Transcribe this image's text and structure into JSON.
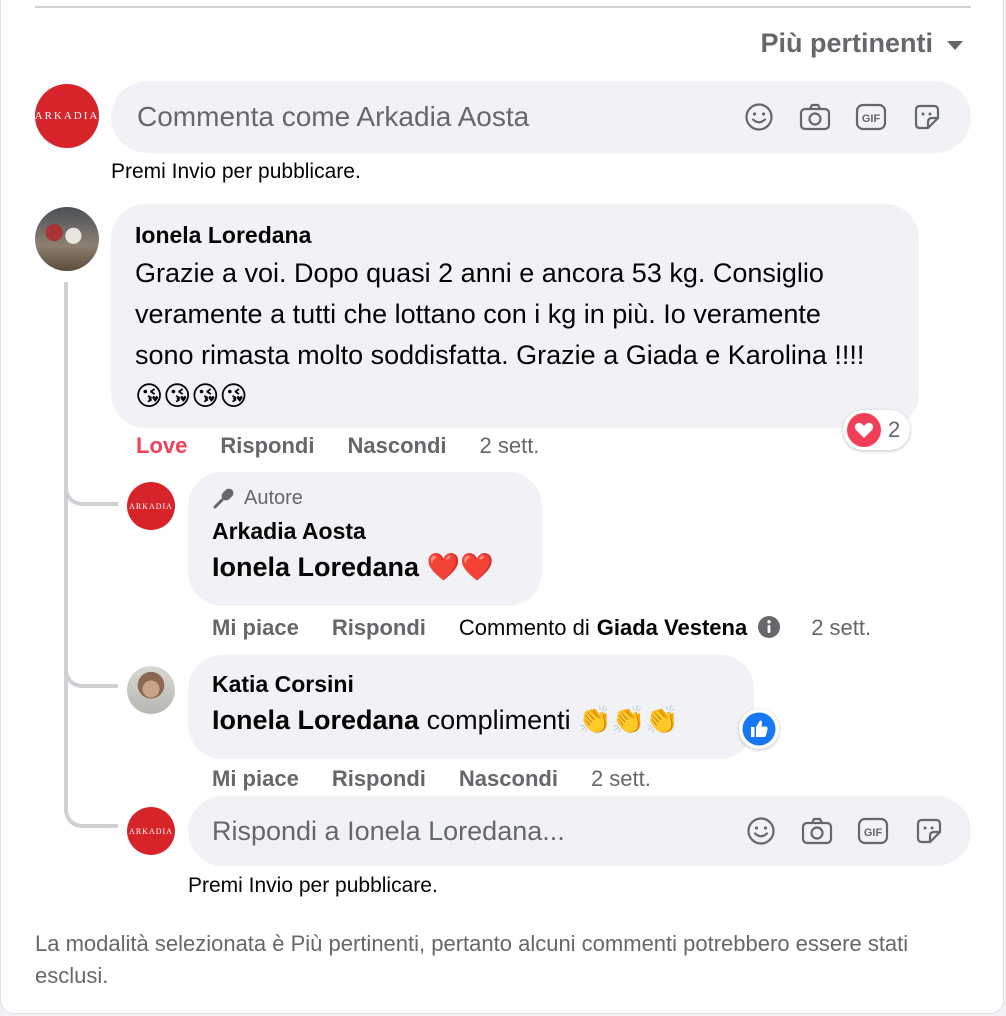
{
  "sort": {
    "label": "Più pertinenti"
  },
  "composer": {
    "placeholder": "Commenta come Arkadia Aosta",
    "hint": "Premi Invio per pubblicare.",
    "avatar_text": "ARKADIA"
  },
  "comment1": {
    "author": "Ionela Loredana",
    "text": "Grazie a voi. Dopo quasi 2 anni e ancora 53 kg. Consiglio veramente a tutti che lottano con i kg in più. Io veramente sono rimasta molto soddisfatta. Grazie a Giada e Karolina !!!! 😘😘😘😘",
    "actions": {
      "react": "Love",
      "reply": "Rispondi",
      "hide": "Nascondi",
      "time": "2 sett."
    },
    "reaction_count": "2",
    "reaction_type": "heart-icon"
  },
  "reply1": {
    "badge": "Autore",
    "author": "Arkadia Aosta",
    "mention": "Ionela Loredana",
    "text": " ❤️❤️",
    "actions": {
      "like": "Mi piace",
      "reply": "Rispondi",
      "comment_by_prefix": "Commento di",
      "comment_by_name": "Giada Vestena",
      "time": "2 sett."
    }
  },
  "reply2": {
    "author": "Katia Corsini",
    "mention": "Ionela Loredana",
    "text": " complimenti 👏👏👏",
    "actions": {
      "like": "Mi piace",
      "reply": "Rispondi",
      "hide": "Nascondi",
      "time": "2 sett."
    }
  },
  "reply_composer": {
    "placeholder": "Rispondi a Ionela Loredana...",
    "hint": "Premi Invio per pubblicare."
  },
  "footer": {
    "text": "La modalità selezionata è Più pertinenti, pertanto alcuni commenti potrebbero essere stati esclusi."
  },
  "colors": {
    "love": "#f33e58",
    "like": "#1877f2",
    "brand": "#d7242b"
  }
}
